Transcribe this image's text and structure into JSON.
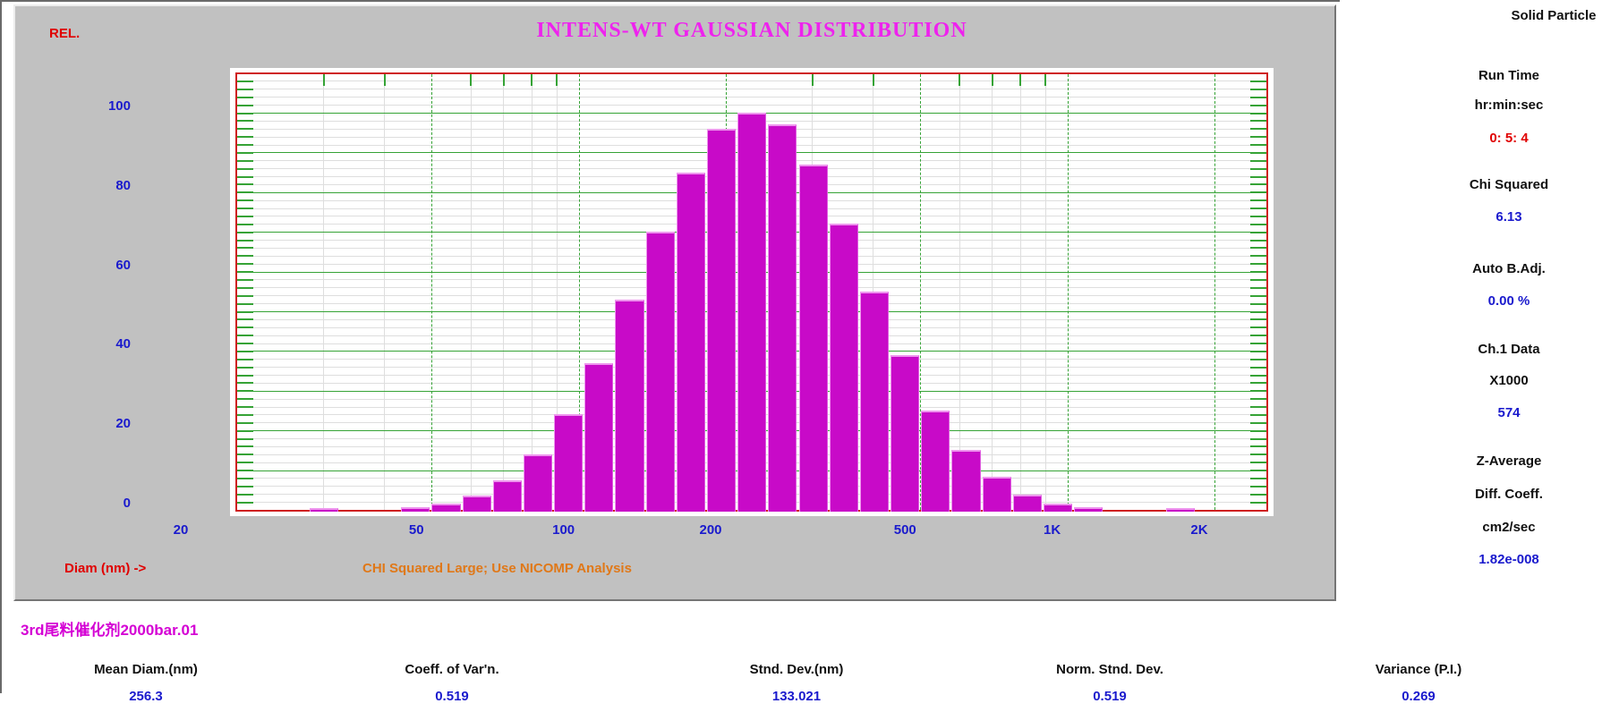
{
  "chart": {
    "rel_label": "REL.",
    "title": "INTENS-WT GAUSSIAN DISTRIBUTION",
    "diam_label": "Diam (nm) ->",
    "warning_message": "CHI Squared Large; Use NICOMP Analysis"
  },
  "chart_data": {
    "type": "bar",
    "title": "INTENS-WT GAUSSIAN DISTRIBUTION",
    "xlabel": "Diam (nm) ->",
    "ylabel": "REL.",
    "x_scale": "log",
    "x_range_nm": [
      20,
      2600
    ],
    "ylim": [
      0,
      110
    ],
    "grid": true,
    "y_major_step": 10,
    "y_minor_step": 2,
    "y_tick_labels": [
      {
        "label": "100",
        "v": 100
      },
      {
        "label": "80",
        "v": 80
      },
      {
        "label": "60",
        "v": 60
      },
      {
        "label": "40",
        "v": 40
      },
      {
        "label": "20",
        "v": 20
      },
      {
        "label": "0",
        "v": 0
      }
    ],
    "x_major_ticks": [
      {
        "label": "20",
        "nm": 20
      },
      {
        "label": "50",
        "nm": 50
      },
      {
        "label": "100",
        "nm": 100
      },
      {
        "label": "200",
        "nm": 200
      },
      {
        "label": "500",
        "nm": 500
      },
      {
        "label": "1K",
        "nm": 1000
      },
      {
        "label": "2K",
        "nm": 2000
      }
    ],
    "x_minor_ticks_nm": [
      30,
      40,
      60,
      70,
      80,
      90,
      300,
      400,
      600,
      700,
      800,
      900
    ],
    "bin_start_nm": 28.0,
    "bin_ratio": 1.155,
    "bin_centers_nm": [
      30,
      35,
      40,
      46,
      54,
      62,
      72,
      83,
      95,
      110,
      127,
      147,
      170,
      196,
      226,
      261,
      302,
      349,
      403,
      465,
      537,
      620,
      716,
      827,
      956,
      1104,
      1275,
      1473,
      1701
    ],
    "values": [
      0.5,
      0,
      0,
      0.7,
      1.5,
      3.5,
      7.5,
      14,
      24,
      37,
      53,
      70,
      85,
      96,
      100,
      97,
      87,
      72,
      55,
      39,
      25,
      15,
      8.4,
      3.8,
      1.6,
      0.6,
      0,
      0,
      0.4
    ]
  },
  "sidebar": {
    "particle_type": "Solid Particle",
    "run_time": {
      "label": "Run Time",
      "units": "hr:min:sec",
      "value": "0: 5: 4"
    },
    "chi_squared": {
      "label": "Chi Squared",
      "value": "6.13"
    },
    "auto_badj": {
      "label": "Auto B.Adj.",
      "value": "0.00 %"
    },
    "ch1_data": {
      "label": "Ch.1 Data",
      "multiplier": "X1000",
      "value": "574"
    },
    "z_average": {
      "label1": "Z-Average",
      "label2": "Diff. Coeff.",
      "units": "cm2/sec",
      "value": "1.82e-008"
    }
  },
  "footer": {
    "filename": "3rd尾料催化剂2000bar.01",
    "stats": [
      {
        "label": "Mean Diam.(nm)",
        "value": "256.3"
      },
      {
        "label": "Coeff. of Var'n.",
        "value": "0.519"
      },
      {
        "label": "Stnd. Dev.(nm)",
        "value": "133.021"
      },
      {
        "label": "Norm. Stnd. Dev.",
        "value": "0.519"
      },
      {
        "label": "Variance (P.I.)",
        "value": "0.269"
      }
    ]
  },
  "colors": {
    "bar": "#c80ac8",
    "grid_green": "#36a336",
    "grid_gray": "#dedede",
    "frame_red": "#cf2020",
    "value_blue": "#1a1acd",
    "text_red": "#e00000",
    "warning_orange": "#e07818",
    "title_magenta": "#ee22ee",
    "panel_gray": "#c1c1c1"
  }
}
